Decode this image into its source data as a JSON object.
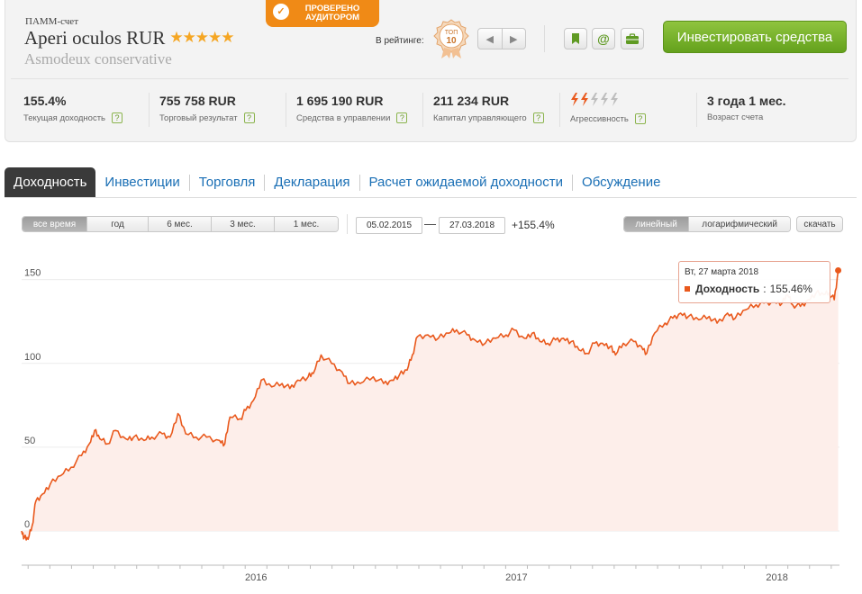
{
  "header": {
    "account_type": "ПАММ-счет",
    "account_name": "Aperi oculos RUR",
    "stars": "★★★★★",
    "strategy": "Asmodeux conservative",
    "audit_line1": "ПРОВЕРЕНО",
    "audit_line2": "АУДИТОРОМ",
    "rating_label": "В рейтинге:",
    "top_badge_line1": "ТОП",
    "top_badge_line2": "10",
    "invest_button": "Инвестировать средства"
  },
  "stats": [
    {
      "value": "155.4%",
      "label": "Текущая доходность"
    },
    {
      "value": "755 758 RUR",
      "label": "Торговый результат"
    },
    {
      "value": "1 695 190 RUR",
      "label": "Средства в управлении"
    },
    {
      "value": "211 234 RUR",
      "label": "Капитал управляющего"
    },
    {
      "value": "",
      "label": "Агрессивность",
      "level": 2,
      "max": 5
    },
    {
      "value": "3 года 1 мес.",
      "label": "Возраст счета"
    }
  ],
  "tabs": [
    "Доходность",
    "Инвестиции",
    "Торговля",
    "Декларация",
    "Расчет ожидаемой доходности",
    "Обсуждение"
  ],
  "periods": [
    "все время",
    "год",
    "6 мес.",
    "3 мес.",
    "1 мес."
  ],
  "date_from": "05.02.2015",
  "date_to": "27.03.2018",
  "change": "+155.4%",
  "scale_options": [
    "линейный",
    "логарифмический"
  ],
  "download": "скачать",
  "tooltip": {
    "date": "Вт, 27 марта 2018",
    "series": "Доходность",
    "value": "155.46%"
  },
  "colors": {
    "accent": "#e9591d",
    "area_fill": "#fdeeea",
    "invest_green": "#74b02a",
    "link_blue": "#1a6fb5",
    "audit_orange": "#f08a16"
  },
  "chart_data": {
    "type": "area",
    "series": [
      {
        "name": "Доходность"
      }
    ],
    "ylim": [
      0,
      160
    ],
    "y_ticks": [
      "0",
      "50",
      "100",
      "150"
    ],
    "x_ticks": [
      "2016",
      "2017",
      "2018"
    ],
    "x_tick_dates": [
      2016.0,
      2017.0,
      2018.0
    ],
    "x_range": [
      2015.1,
      2018.24
    ],
    "grid": true,
    "points": [
      [
        2015.1,
        0
      ],
      [
        2015.11,
        -4
      ],
      [
        2015.125,
        -5
      ],
      [
        2015.14,
        3
      ],
      [
        2015.155,
        18
      ],
      [
        2015.18,
        22
      ],
      [
        2015.21,
        28
      ],
      [
        2015.25,
        33
      ],
      [
        2015.29,
        38
      ],
      [
        2015.33,
        45
      ],
      [
        2015.36,
        52
      ],
      [
        2015.38,
        60
      ],
      [
        2015.4,
        55
      ],
      [
        2015.43,
        52
      ],
      [
        2015.46,
        60
      ],
      [
        2015.5,
        55
      ],
      [
        2015.53,
        56
      ],
      [
        2015.57,
        54
      ],
      [
        2015.6,
        56
      ],
      [
        2015.64,
        58
      ],
      [
        2015.67,
        56
      ],
      [
        2015.7,
        70
      ],
      [
        2015.73,
        58
      ],
      [
        2015.77,
        56
      ],
      [
        2015.81,
        56
      ],
      [
        2015.86,
        54
      ],
      [
        2015.88,
        52
      ],
      [
        2015.9,
        68
      ],
      [
        2015.94,
        67
      ],
      [
        2015.96,
        72
      ],
      [
        2015.99,
        78
      ],
      [
        2016.02,
        90
      ],
      [
        2016.06,
        86
      ],
      [
        2016.1,
        88
      ],
      [
        2016.13,
        85
      ],
      [
        2016.16,
        90
      ],
      [
        2016.2,
        92
      ],
      [
        2016.22,
        94
      ],
      [
        2016.25,
        105
      ],
      [
        2016.29,
        100
      ],
      [
        2016.33,
        95
      ],
      [
        2016.36,
        88
      ],
      [
        2016.4,
        88
      ],
      [
        2016.45,
        92
      ],
      [
        2016.49,
        88
      ],
      [
        2016.52,
        90
      ],
      [
        2016.55,
        93
      ],
      [
        2016.58,
        96
      ],
      [
        2016.6,
        105
      ],
      [
        2016.62,
        116
      ],
      [
        2016.66,
        117
      ],
      [
        2016.7,
        115
      ],
      [
        2016.74,
        118
      ],
      [
        2016.77,
        120
      ],
      [
        2016.81,
        117
      ],
      [
        2016.84,
        114
      ],
      [
        2016.88,
        112
      ],
      [
        2016.92,
        115
      ],
      [
        2016.96,
        117
      ],
      [
        2016.99,
        120
      ],
      [
        2017.03,
        115
      ],
      [
        2017.06,
        118
      ],
      [
        2017.09,
        113
      ],
      [
        2017.12,
        112
      ],
      [
        2017.15,
        114
      ],
      [
        2017.18,
        115
      ],
      [
        2017.21,
        113
      ],
      [
        2017.24,
        108
      ],
      [
        2017.27,
        106
      ],
      [
        2017.3,
        112
      ],
      [
        2017.33,
        112
      ],
      [
        2017.36,
        110
      ],
      [
        2017.38,
        105
      ],
      [
        2017.41,
        112
      ],
      [
        2017.45,
        113
      ],
      [
        2017.48,
        110
      ],
      [
        2017.5,
        106
      ],
      [
        2017.53,
        118
      ],
      [
        2017.57,
        124
      ],
      [
        2017.6,
        127
      ],
      [
        2017.63,
        130
      ],
      [
        2017.66,
        128
      ],
      [
        2017.7,
        126
      ],
      [
        2017.74,
        128
      ],
      [
        2017.77,
        124
      ],
      [
        2017.81,
        130
      ],
      [
        2017.84,
        127
      ],
      [
        2017.88,
        132
      ],
      [
        2017.92,
        135
      ],
      [
        2017.95,
        136
      ],
      [
        2017.99,
        137
      ],
      [
        2018.02,
        136
      ],
      [
        2018.04,
        141
      ],
      [
        2018.06,
        135
      ],
      [
        2018.09,
        134
      ],
      [
        2018.12,
        138
      ],
      [
        2018.15,
        142
      ],
      [
        2018.18,
        141
      ],
      [
        2018.2,
        142
      ],
      [
        2018.22,
        138
      ],
      [
        2018.235,
        155.46
      ]
    ]
  }
}
